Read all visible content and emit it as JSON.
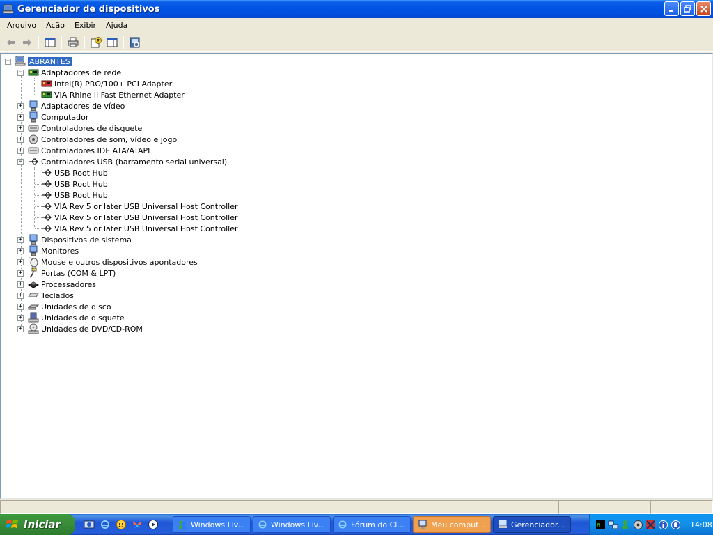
{
  "window": {
    "title": "Gerenciador de dispositivos"
  },
  "menu": {
    "items": [
      "Arquivo",
      "Ação",
      "Exibir",
      "Ajuda"
    ]
  },
  "tree": {
    "root": "ABRANTES",
    "nodes": [
      {
        "label": "Adaptadores de rede",
        "expanded": true,
        "icon": "network-icon",
        "children": [
          "Intel(R) PRO/100+ PCI Adapter",
          "VIA Rhine II Fast Ethernet Adapter"
        ]
      },
      {
        "label": "Adaptadores de vídeo",
        "expanded": false,
        "icon": "display-icon"
      },
      {
        "label": "Computador",
        "expanded": false,
        "icon": "computer-icon"
      },
      {
        "label": "Controladores de disquete",
        "expanded": false,
        "icon": "floppy-controller-icon"
      },
      {
        "label": "Controladores de som, vídeo e jogo",
        "expanded": false,
        "icon": "sound-icon"
      },
      {
        "label": "Controladores IDE ATA/ATAPI",
        "expanded": false,
        "icon": "ide-icon"
      },
      {
        "label": "Controladores USB (barramento serial universal)",
        "expanded": true,
        "icon": "usb-icon",
        "children": [
          "USB Root Hub",
          "USB Root Hub",
          "USB Root Hub",
          "VIA Rev 5 or later USB Universal Host Controller",
          "VIA Rev 5 or later USB Universal Host Controller",
          "VIA Rev 5 or later USB Universal Host Controller"
        ]
      },
      {
        "label": "Dispositivos de sistema",
        "expanded": false,
        "icon": "system-icon"
      },
      {
        "label": "Monitores",
        "expanded": false,
        "icon": "monitor-icon"
      },
      {
        "label": "Mouse e outros dispositivos apontadores",
        "expanded": false,
        "icon": "mouse-icon"
      },
      {
        "label": "Portas (COM & LPT)",
        "expanded": false,
        "icon": "port-icon"
      },
      {
        "label": "Processadores",
        "expanded": false,
        "icon": "processor-icon"
      },
      {
        "label": "Teclados",
        "expanded": false,
        "icon": "keyboard-icon"
      },
      {
        "label": "Unidades de disco",
        "expanded": false,
        "icon": "disk-icon"
      },
      {
        "label": "Unidades de disquete",
        "expanded": false,
        "icon": "floppy-icon"
      },
      {
        "label": "Unidades de DVD/CD-ROM",
        "expanded": false,
        "icon": "cdrom-icon"
      }
    ]
  },
  "taskbar": {
    "start_label": "Iniciar",
    "tasks": [
      {
        "label": "Windows Liv...",
        "icon": "messenger-icon",
        "state": "normal"
      },
      {
        "label": "Windows Liv...",
        "icon": "ie-icon",
        "state": "normal"
      },
      {
        "label": "Fórum do Cl...",
        "icon": "ie-icon",
        "state": "normal"
      },
      {
        "label": "Meu comput...",
        "icon": "computer-icon",
        "state": "highlight"
      },
      {
        "label": "Gerenciador...",
        "icon": "device-manager-icon",
        "state": "active"
      }
    ],
    "clock": "14:08"
  },
  "colors": {
    "titlebar": "#0054e3",
    "selection": "#316ac5",
    "taskbar": "#245edb",
    "start": "#3a8f3a",
    "tray": "#1290e8"
  }
}
